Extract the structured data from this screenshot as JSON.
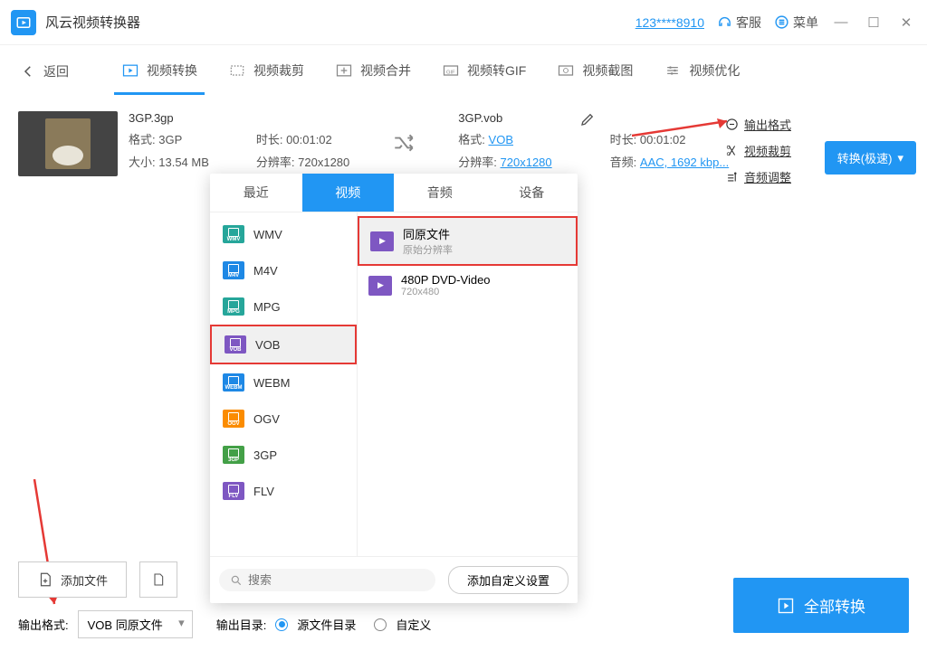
{
  "app": {
    "title": "风云视频转换器"
  },
  "titlebar": {
    "phone": "123****8910",
    "support": "客服",
    "menu": "菜单"
  },
  "back_label": "返回",
  "tabs": {
    "convert": "视频转换",
    "crop": "视频裁剪",
    "merge": "视频合并",
    "gif": "视频转GIF",
    "screenshot": "视频截图",
    "optimize": "视频优化"
  },
  "file": {
    "name_in": "3GP.3gp",
    "fmt_label": "格式:",
    "fmt_in": "3GP",
    "size_label": "大小:",
    "size": "13.54 MB",
    "dur_label": "时长:",
    "dur": "00:01:02",
    "res_label": "分辨率:",
    "res": "720x1280",
    "name_out": "3GP.vob",
    "fmt_out": "VOB",
    "res_out": "720x1280",
    "audio_label": "音频:",
    "audio": "AAC, 1692 kbp..."
  },
  "sideopts": {
    "out_format": "输出格式",
    "video_crop": "视频裁剪",
    "audio_adj": "音频调整"
  },
  "convert_chip": "转换(极速)",
  "popup": {
    "tab_recent": "最近",
    "tab_video": "视频",
    "tab_audio": "音频",
    "tab_device": "设备",
    "formats": {
      "wmv": "WMV",
      "m4v": "M4V",
      "mpg": "MPG",
      "vob": "VOB",
      "webm": "WEBM",
      "ogv": "OGV",
      "gp3": "3GP",
      "flv": "FLV"
    },
    "res1_title": "同原文件",
    "res1_sub": "原始分辨率",
    "res2_title": "480P DVD-Video",
    "res2_sub": "720x480",
    "search_ph": "搜索",
    "custom_btn": "添加自定义设置"
  },
  "bottom": {
    "add_file": "添加文件",
    "out_fmt_label": "输出格式:",
    "out_fmt_val": "VOB 同原文件",
    "out_dir_label": "输出目录:",
    "src_dir": "源文件目录",
    "custom_dir": "自定义",
    "convert_all": "全部转换"
  }
}
